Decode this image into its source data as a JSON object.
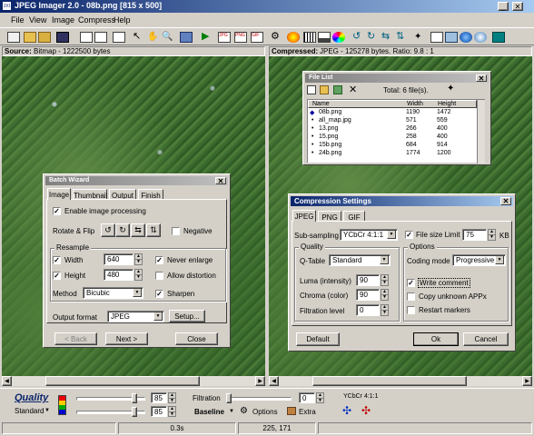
{
  "window": {
    "title": "JPEG Imager 2.0 - 08b.png [815 x 500]"
  },
  "menu": [
    "File",
    "View",
    "Image",
    "Compress",
    "Help"
  ],
  "source": {
    "label": "Source:",
    "info": "Bitmap - 1222500 bytes"
  },
  "compressed": {
    "label": "Compressed:",
    "info": "JPEG - 125278 bytes. Ratio: 9.8 : 1"
  },
  "file_list": {
    "title": "File List",
    "total": "Total: 6 file(s).",
    "columns": [
      "Name",
      "Width",
      "Height"
    ],
    "rows": [
      {
        "name": "08b.png",
        "width": "1190",
        "height": "1472"
      },
      {
        "name": "all_map.jpg",
        "width": "571",
        "height": "559"
      },
      {
        "name": "13.png",
        "width": "266",
        "height": "400"
      },
      {
        "name": "15.png",
        "width": "258",
        "height": "400"
      },
      {
        "name": "15b.png",
        "width": "684",
        "height": "914"
      },
      {
        "name": "24b.png",
        "width": "1774",
        "height": "1200"
      }
    ]
  },
  "batch": {
    "title": "Batch Wizard",
    "tabs": [
      "Image",
      "Thumbnail",
      "Output",
      "Finish"
    ],
    "enable_label": "Enable image processing",
    "rotate_label": "Rotate & Flip",
    "negative_label": "Negative",
    "resample_title": "Resample",
    "width_label": "Width",
    "width_value": "640",
    "height_label": "Height",
    "height_value": "480",
    "never_enlarge": "Never enlarge",
    "allow_distortion": "Allow distortion",
    "method_label": "Method",
    "method_value": "Bicubic",
    "sharpen_label": "Sharpen",
    "output_label": "Output format",
    "output_value": "JPEG",
    "setup_label": "Setup...",
    "back_label": "< Back",
    "next_label": "Next >",
    "close_label": "Close"
  },
  "compression": {
    "title": "Compression Settings",
    "tabs": [
      "JPEG",
      "PNG",
      "GIF"
    ],
    "subsampling_label": "Sub-sampling",
    "subsampling_value": "YCbCr 4:1:1",
    "file_size_limit_label": "File size Limit",
    "file_size_value": "75",
    "kb_label": "KB",
    "quality_title": "Quality",
    "qtable_label": "Q-Table",
    "qtable_value": "Standard",
    "luma_label": "Luma (intensity)",
    "luma_value": "90",
    "chroma_label": "Chroma (color)",
    "chroma_value": "90",
    "filtration_label": "Filtration level",
    "filtration_value": "0",
    "options_title": "Options",
    "coding_label": "Coding mode",
    "coding_value": "Progressive",
    "write_comment": "Write comment",
    "copy_app": "Copy unknown APPx",
    "restart_markers": "Restart markers",
    "default_label": "Default",
    "ok_label": "Ok",
    "cancel_label": "Cancel"
  },
  "bottom": {
    "quality_label": "Quality",
    "standard_label": "Standard",
    "value1": "85",
    "value2": "85",
    "filtration_label": "Filtration",
    "filtration_value": "0",
    "baseline_label": "Baseline",
    "options_label": "Options",
    "extra_label": "Extra",
    "ycbcr_label": "YCbCr 4:1:1"
  },
  "status": {
    "time": "0.3s",
    "coords": "225, 171"
  },
  "colors": {
    "title_active": "#0a246a",
    "face": "#d4d0c8",
    "quality_blue": "#0a246a"
  }
}
